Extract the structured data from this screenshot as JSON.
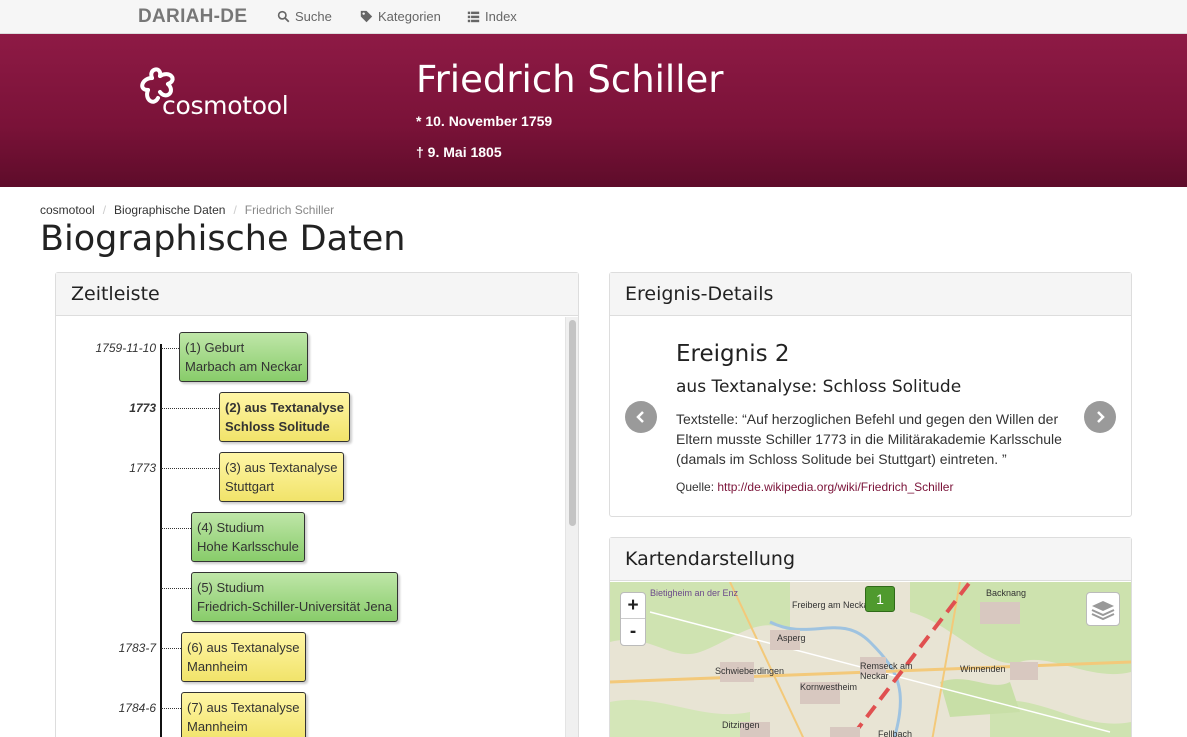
{
  "navbar": {
    "brand": "DARIAH-DE",
    "items": [
      {
        "label": "Suche",
        "icon": "search-icon"
      },
      {
        "label": "Kategorien",
        "icon": "tag-icon"
      },
      {
        "label": "Index",
        "icon": "list-icon"
      }
    ]
  },
  "header": {
    "logo_text": "cosmotool",
    "person_name": "Friedrich Schiller",
    "birth": "* 10. November 1759",
    "death": "† 9. Mai 1805"
  },
  "breadcrumb": [
    "cosmotool",
    "Biographische Daten",
    "Friedrich Schiller"
  ],
  "page_title": "Biographische Daten",
  "timeline": {
    "title": "Zeitleiste",
    "items": [
      {
        "date": "1759-11-10",
        "line1": "(1) Geburt",
        "line2": "Marbach am Neckar",
        "kind": "green"
      },
      {
        "date": "1773",
        "line1": "(2) aus Textanalyse",
        "line2": "Schloss Solitude",
        "kind": "yellow"
      },
      {
        "date": "1773",
        "line1": "(3) aus Textanalyse",
        "line2": "Stuttgart",
        "kind": "yellow"
      },
      {
        "date": "",
        "line1": "(4) Studium",
        "line2": "Hohe Karlsschule",
        "kind": "green"
      },
      {
        "date": "",
        "line1": "(5) Studium",
        "line2": "Friedrich-Schiller-Universität Jena",
        "kind": "green"
      },
      {
        "date": "1783-7",
        "line1": "(6) aus Textanalyse",
        "line2": "Mannheim",
        "kind": "yellow"
      },
      {
        "date": "1784-6",
        "line1": "(7) aus Textanalyse",
        "line2": "Mannheim",
        "kind": "yellow"
      }
    ]
  },
  "event": {
    "panel_title": "Ereignis-Details",
    "title": "Ereignis 2",
    "subtitle": "aus Textanalyse: Schloss Solitude",
    "text": "Textstelle: “Auf herzoglichen Befehl und gegen den Willen der Eltern musste Schiller 1773 in die Militärakademie Karlsschule (damals im Schloss Solitude bei Stuttgart) eintreten. ”",
    "source_label": "Quelle:",
    "source_link": "http://de.wikipedia.org/wiki/Friedrich_Schiller"
  },
  "map": {
    "panel_title": "Kartendarstellung",
    "zoom_in": "+",
    "zoom_out": "-",
    "cluster_count": "1",
    "places": [
      "Freiberg am Neckar",
      "Backnang",
      "Asperg",
      "Schwieberdingen",
      "Remseck am Neckar",
      "Winnenden",
      "Kornwestheim",
      "Ditzingen",
      "Fellbach",
      "Bietigheim an der Enz"
    ]
  },
  "colors": {
    "header": "#7a1238",
    "green_event": "#88cc6a",
    "yellow_event": "#f1e36a",
    "link": "#7a1238"
  }
}
